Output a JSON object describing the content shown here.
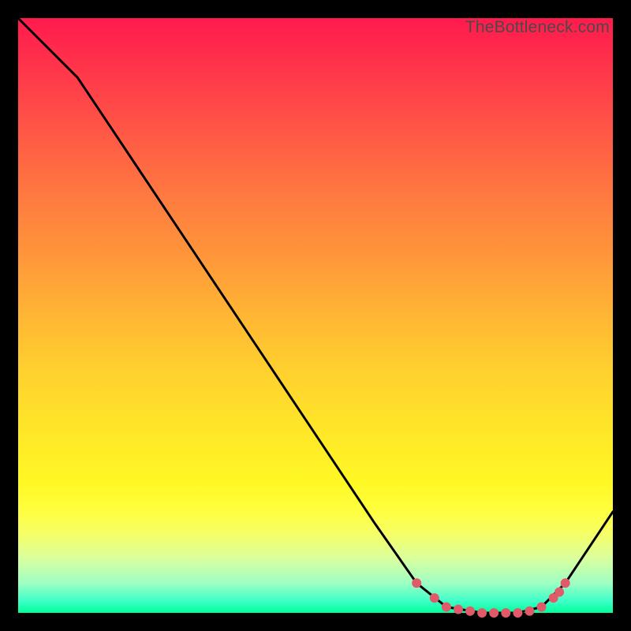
{
  "watermark": "TheBottleneck.com",
  "chart_data": {
    "type": "line",
    "title": "",
    "xlabel": "",
    "ylabel": "",
    "xlim": [
      0,
      100
    ],
    "ylim": [
      0,
      100
    ],
    "series": [
      {
        "name": "curve",
        "x": [
          0,
          10,
          20,
          30,
          40,
          50,
          60,
          67,
          72,
          78,
          84,
          88,
          92,
          100
        ],
        "y": [
          100,
          90,
          75,
          60,
          45,
          30,
          15,
          5,
          1,
          0,
          0,
          1,
          5,
          17
        ]
      }
    ],
    "markers": {
      "name": "dots",
      "x": [
        67,
        70,
        72,
        74,
        76,
        78,
        80,
        82,
        84,
        86,
        88,
        90,
        91,
        92
      ],
      "y": [
        5,
        2.5,
        1,
        0.6,
        0.3,
        0,
        0,
        0,
        0,
        0.3,
        1,
        2.5,
        3.5,
        5
      ]
    },
    "gradient_stops": [
      {
        "pos": 0,
        "color": "#ff1a4d"
      },
      {
        "pos": 50,
        "color": "#ffd22e"
      },
      {
        "pos": 85,
        "color": "#ffff40"
      },
      {
        "pos": 100,
        "color": "#00ff99"
      }
    ]
  }
}
